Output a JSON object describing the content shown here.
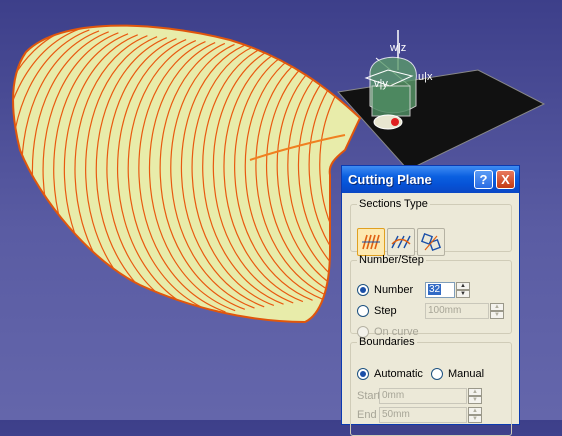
{
  "dialog": {
    "title": "Cutting Plane",
    "help_label": "?",
    "close_label": "X",
    "sections_type": {
      "legend": "Sections Type",
      "buttons": [
        "parallel-sections",
        "perpendicular-sections",
        "plane-section-along-curve"
      ]
    },
    "number_step": {
      "legend": "Number/Step",
      "number_label": "Number",
      "number_value": "32",
      "step_label": "Step",
      "step_value": "100mm",
      "on_curve_label": "On curve",
      "selected": "Number"
    },
    "boundaries": {
      "legend": "Boundaries",
      "automatic_label": "Automatic",
      "manual_label": "Manual",
      "selected": "Automatic",
      "start_label": "Start",
      "start_value": "0mm",
      "end_label": "End",
      "end_value": "50mm"
    }
  },
  "compass": {
    "w_label": "w|z",
    "u_label": "u|x",
    "v_label": "v|y"
  },
  "colors": {
    "background": "#4a4c96",
    "surface_fill": "#e8ecaa",
    "section_lines": "#e85a10",
    "titlebar": "#0a5fe0"
  }
}
